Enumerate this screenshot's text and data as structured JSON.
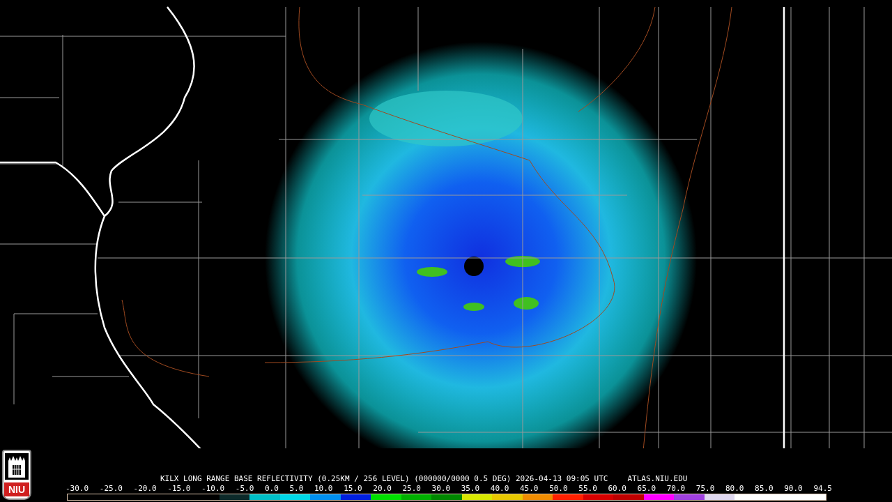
{
  "logo": {
    "text": "NIU"
  },
  "caption": {
    "product": "KILX LONG RANGE BASE REFLECTIVITY (0.25KM / 256 LEVEL) (000000/0000 0.5 DEG) 2026-04-13 09:05 UTC",
    "source": "ATLAS.NIU.EDU"
  },
  "color_scale": {
    "labels": [
      "-30.0",
      "-25.0",
      "-20.0",
      "-15.0",
      "-10.0",
      "-5.0",
      "0.0",
      "5.0",
      "10.0",
      "15.0",
      "20.0",
      "25.0",
      "30.0",
      "35.0",
      "40.0",
      "45.0",
      "50.0",
      "55.0",
      "60.0",
      "65.0",
      "70.0",
      "75.0",
      "80.0",
      "85.0",
      "90.0",
      "94.5"
    ],
    "segments": [
      {
        "color": "#0c2a2a"
      },
      {
        "color": "#00c0c8"
      },
      {
        "color": "#00d8e8"
      },
      {
        "color": "#0090f0"
      },
      {
        "color": "#0020e0"
      },
      {
        "color": "#00e000"
      },
      {
        "color": "#00b000"
      },
      {
        "color": "#008800"
      },
      {
        "color": "#d8e800"
      },
      {
        "color": "#e8c800"
      },
      {
        "color": "#f08c00"
      },
      {
        "color": "#ff2000"
      },
      {
        "color": "#d80000"
      },
      {
        "color": "#c00000"
      },
      {
        "color": "#ff00ff"
      },
      {
        "color": "#a040e0"
      },
      {
        "color": "#e0d8f0"
      },
      {
        "color": "#ffffff"
      },
      {
        "color": "#ffffff"
      },
      {
        "color": "#ffffff"
      }
    ]
  }
}
